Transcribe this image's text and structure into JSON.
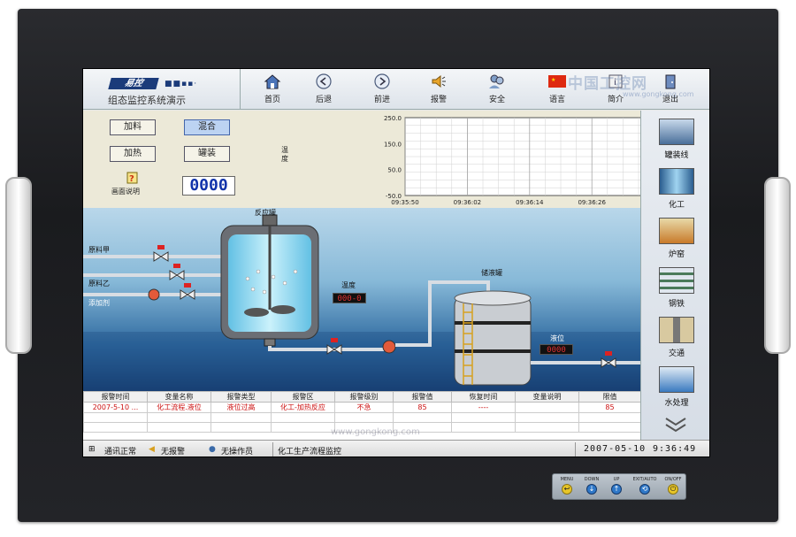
{
  "toolbar": {
    "logo_text": "易控",
    "logo_subtitle": "组态监控系统演示",
    "buttons": [
      {
        "id": "home",
        "label": "首页"
      },
      {
        "id": "back",
        "label": "后退"
      },
      {
        "id": "forward",
        "label": "前进"
      },
      {
        "id": "alarm",
        "label": "报警"
      },
      {
        "id": "security",
        "label": "安全"
      },
      {
        "id": "language",
        "label": "语言"
      },
      {
        "id": "intro",
        "label": "简介"
      },
      {
        "id": "exit",
        "label": "退出"
      }
    ],
    "watermark": "中国工控网",
    "watermark_url": "www.gongkong.com"
  },
  "control": {
    "btn_feed": "加料",
    "btn_mix": "混合",
    "btn_heat": "加热",
    "btn_fill": "罐装",
    "help_label": "画面说明",
    "counter": "0000"
  },
  "trend": {
    "ylabel": "温度",
    "y_ticks": [
      "250.0",
      "150.0",
      "50.0",
      "-50.0"
    ],
    "x_ticks": [
      "09:35:50",
      "09:36:02",
      "09:36:14",
      "09:36:26",
      "09:36:38",
      "09:36:50"
    ]
  },
  "process": {
    "reactor_label": "反应罐",
    "storage_label": "储液罐",
    "line_a": "原料甲",
    "line_b": "原料乙",
    "line_c": "添加剂",
    "temp_label": "温度",
    "temp_value": "000-0",
    "level_label": "液位",
    "level_value": "0000"
  },
  "alarm_table": {
    "headers": [
      "报警时间",
      "变量名称",
      "报警类型",
      "报警区",
      "报警级别",
      "报警值",
      "恢复时间",
      "变量说明",
      "限值"
    ],
    "rows": [
      [
        "2007-5-10 ...",
        "化工流程.液位",
        "液位过高",
        "化工-加热反应",
        "不急",
        "85",
        "----",
        "",
        "85"
      ]
    ],
    "watermark": "www.gongkong.com"
  },
  "side_nav": [
    {
      "label": "罐装线"
    },
    {
      "label": "化工"
    },
    {
      "label": "炉窑"
    },
    {
      "label": "钢铁"
    },
    {
      "label": "交通"
    },
    {
      "label": "水处理"
    }
  ],
  "status_bar": {
    "comm": "通讯正常",
    "alarm": "无报警",
    "operator": "无操作员",
    "screen": "化工生产流程监控",
    "date": "2007-05-10",
    "time": "9:36:49"
  },
  "hardware_keys": [
    {
      "label": "MENU",
      "glyph": "↩"
    },
    {
      "label": "DOWN",
      "glyph": "↓"
    },
    {
      "label": "UP",
      "glyph": "↑"
    },
    {
      "label": "EXIT/AUTO",
      "glyph": "⟲"
    },
    {
      "label": "ON/OFF",
      "glyph": "⏻"
    }
  ],
  "colors": {
    "bezel": "#1f2024",
    "alarm_text": "#cc1111",
    "digit_red": "#e03030",
    "counter_blue": "#1133aa"
  }
}
